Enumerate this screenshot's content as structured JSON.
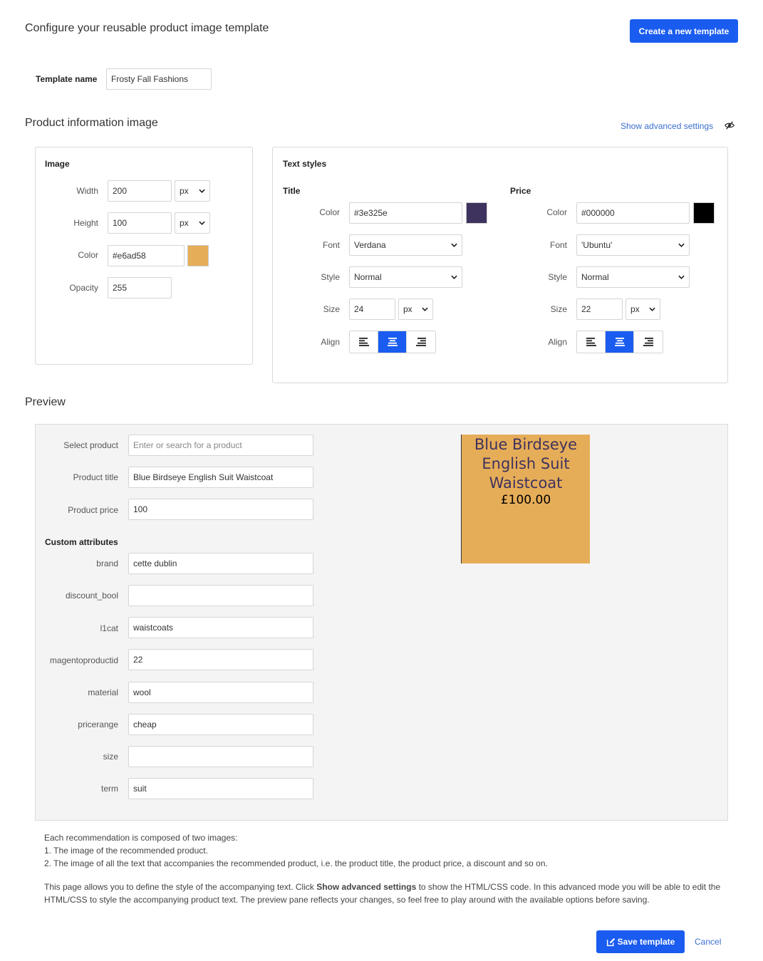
{
  "header": {
    "title": "Configure your reusable product image template",
    "create_button": "Create a new template"
  },
  "template_name": {
    "label": "Template name",
    "value": "Frosty Fall Fashions"
  },
  "product_info": {
    "title": "Product information image",
    "advanced_link": "Show advanced settings",
    "advanced_icon": "eye-slash-icon"
  },
  "image_panel": {
    "heading": "Image",
    "width_label": "Width",
    "width_value": "200",
    "width_unit": "px",
    "height_label": "Height",
    "height_value": "100",
    "height_unit": "px",
    "color_label": "Color",
    "color_value": "#e6ad58",
    "color_swatch": "#e6ad58",
    "opacity_label": "Opacity",
    "opacity_value": "255"
  },
  "text_styles": {
    "heading": "Text styles",
    "title": {
      "heading": "Title",
      "color_label": "Color",
      "color_value": "#3e325e",
      "color_swatch": "#3e325e",
      "font_label": "Font",
      "font_value": "Verdana",
      "style_label": "Style",
      "style_value": "Normal",
      "size_label": "Size",
      "size_value": "24",
      "size_unit": "px",
      "align_label": "Align",
      "align_selected": "center"
    },
    "price": {
      "heading": "Price",
      "color_label": "Color",
      "color_value": "#000000",
      "color_swatch": "#000000",
      "font_label": "Font",
      "font_value": "'Ubuntu'",
      "style_label": "Style",
      "style_value": "Normal",
      "size_label": "Size",
      "size_value": "22",
      "size_unit": "px",
      "align_label": "Align",
      "align_selected": "center"
    }
  },
  "preview": {
    "title": "Preview",
    "select_product_label": "Select product",
    "select_product_placeholder": "Enter or search for a product",
    "product_title_label": "Product title",
    "product_title_value": "Blue Birdseye English Suit Waistcoat",
    "product_price_label": "Product price",
    "product_price_value": "100",
    "custom_attributes_heading": "Custom attributes",
    "attributes": [
      {
        "label": "brand",
        "value": "cette dublin"
      },
      {
        "label": "discount_bool",
        "value": ""
      },
      {
        "label": "l1cat",
        "value": "waistcoats"
      },
      {
        "label": "magentoproductid",
        "value": "22"
      },
      {
        "label": "material",
        "value": "wool"
      },
      {
        "label": "pricerange",
        "value": "cheap"
      },
      {
        "label": "size",
        "value": ""
      },
      {
        "label": "term",
        "value": "suit"
      }
    ],
    "image": {
      "title_lines": [
        "Blue Birdseye",
        "English Suit",
        "Waistcoat"
      ],
      "price": "£100.00",
      "background": "#e6ad58"
    }
  },
  "info": {
    "line1": "Each recommendation is composed of two images:",
    "line2": "1. The image of the recommended product.",
    "line3": "2. The image of all the text that accompanies the recommended product, i.e. the product title, the product price, a discount and so on.",
    "para_before": "This page allows you to define the style of the accompanying text. Click ",
    "para_bold": "Show advanced settings",
    "para_after": " to show the HTML/CSS code. In this advanced mode you will be able to edit the HTML/CSS to style the accompanying product text. The preview pane reflects your changes, so feel free to play around with the available options before saving."
  },
  "footer": {
    "save_button": "Save template",
    "save_icon": "edit-icon",
    "cancel_link": "Cancel"
  }
}
